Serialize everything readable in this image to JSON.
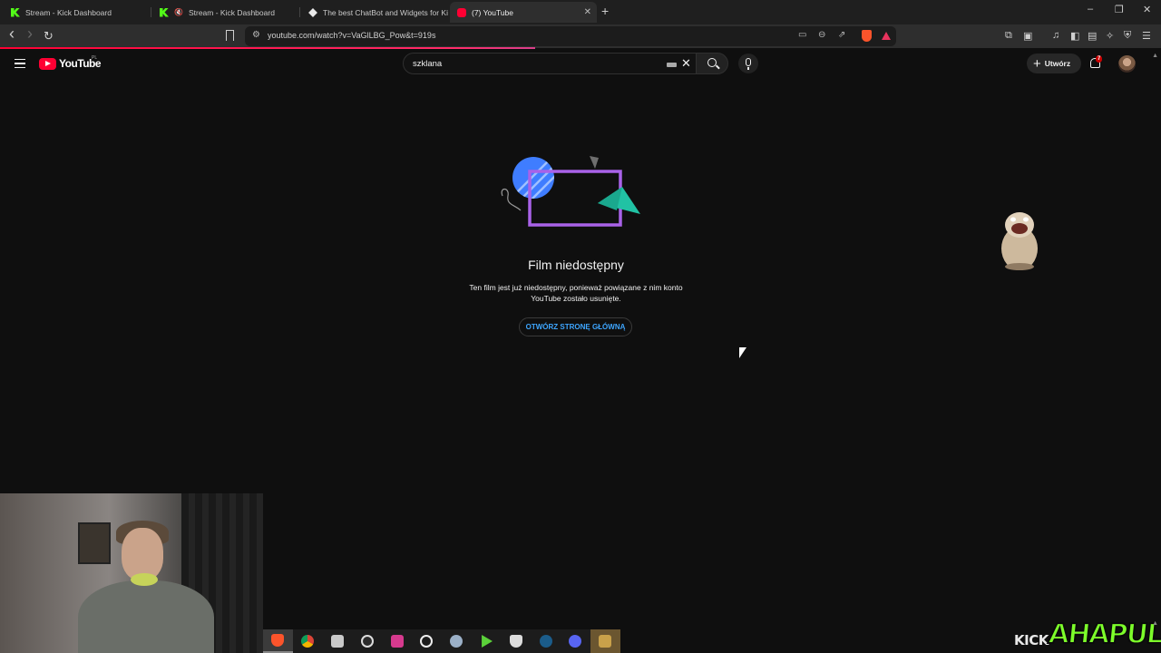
{
  "browser": {
    "tabs": [
      {
        "title": "Stream - Kick Dashboard",
        "favicon": "kick-icon",
        "active": false
      },
      {
        "title": "Stream - Kick Dashboard",
        "favicon": "kick-icon",
        "active": false,
        "muted": true
      },
      {
        "title": "The best ChatBot and Widgets for Ki",
        "favicon": "diamond-icon",
        "active": false
      },
      {
        "title": "(7) YouTube",
        "favicon": "youtube-icon",
        "active": true
      }
    ],
    "url": "youtube.com/watch?v=VaGlLBG_Pow&t=919s",
    "icons": {
      "back": "‹",
      "forward": "›",
      "reload": "↻",
      "new_tab": "+",
      "minimize": "–",
      "maximize": "❐",
      "close": "✕"
    }
  },
  "youtube": {
    "logo_text": "YouTube",
    "country_code": "PL",
    "search": {
      "value": "szklana",
      "clear": "✕"
    },
    "create_label": "Utwórz",
    "notification_count": "7",
    "accent_color": "#ff0033"
  },
  "error": {
    "title": "Film niedostępny",
    "description": "Ten film jest już niedostępny, ponieważ powiązane z nim konto YouTube zostało usunięte.",
    "home_button": "OTWÓRZ STRONĘ GŁÓWNĄ",
    "link_color": "#3ea6ff"
  },
  "taskbar": {
    "apps": [
      "brave-icon",
      "chrome-icon",
      "files-icon",
      "obs-icon",
      "game-launcher-icon",
      "logitech-icon",
      "app-icon",
      "play-icon",
      "shield-icon",
      "steam-icon",
      "discord-icon",
      "league-icon"
    ]
  },
  "overlay": {
    "brand_word": "KICK",
    "channel_name": "AHAPULCO"
  }
}
